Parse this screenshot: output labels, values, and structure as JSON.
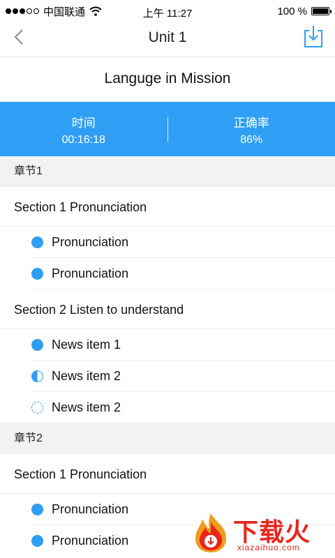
{
  "status_bar": {
    "carrier": "中国联通",
    "time": "上午 11:27",
    "battery": "100 %"
  },
  "nav": {
    "title": "Unit 1"
  },
  "lesson": {
    "title": "Languge in Mission"
  },
  "stats": [
    {
      "label": "时间",
      "value": "00:16:18"
    },
    {
      "label": "正确率",
      "value": "86%"
    }
  ],
  "chapters": [
    {
      "title": "章节1",
      "sections": [
        {
          "title": "Section 1 Pronunciation",
          "items": [
            {
              "label": "Pronunciation",
              "status": "full"
            },
            {
              "label": "Pronunciation",
              "status": "full"
            }
          ]
        },
        {
          "title": "Section 2 Listen to understand",
          "items": [
            {
              "label": "News item 1",
              "status": "full"
            },
            {
              "label": "News item 2",
              "status": "half"
            },
            {
              "label": "News item 2",
              "status": "empty"
            }
          ]
        }
      ]
    },
    {
      "title": "章节2",
      "sections": [
        {
          "title": "Section 1 Pronunciation",
          "items": [
            {
              "label": "Pronunciation",
              "status": "full"
            },
            {
              "label": "Pronunciation",
              "status": "full"
            }
          ]
        }
      ]
    }
  ],
  "watermark": {
    "text": "下载火",
    "url": "xiazaihuo.com"
  },
  "colors": {
    "accent": "#2f9ef5",
    "watermark": "#e8251b"
  }
}
